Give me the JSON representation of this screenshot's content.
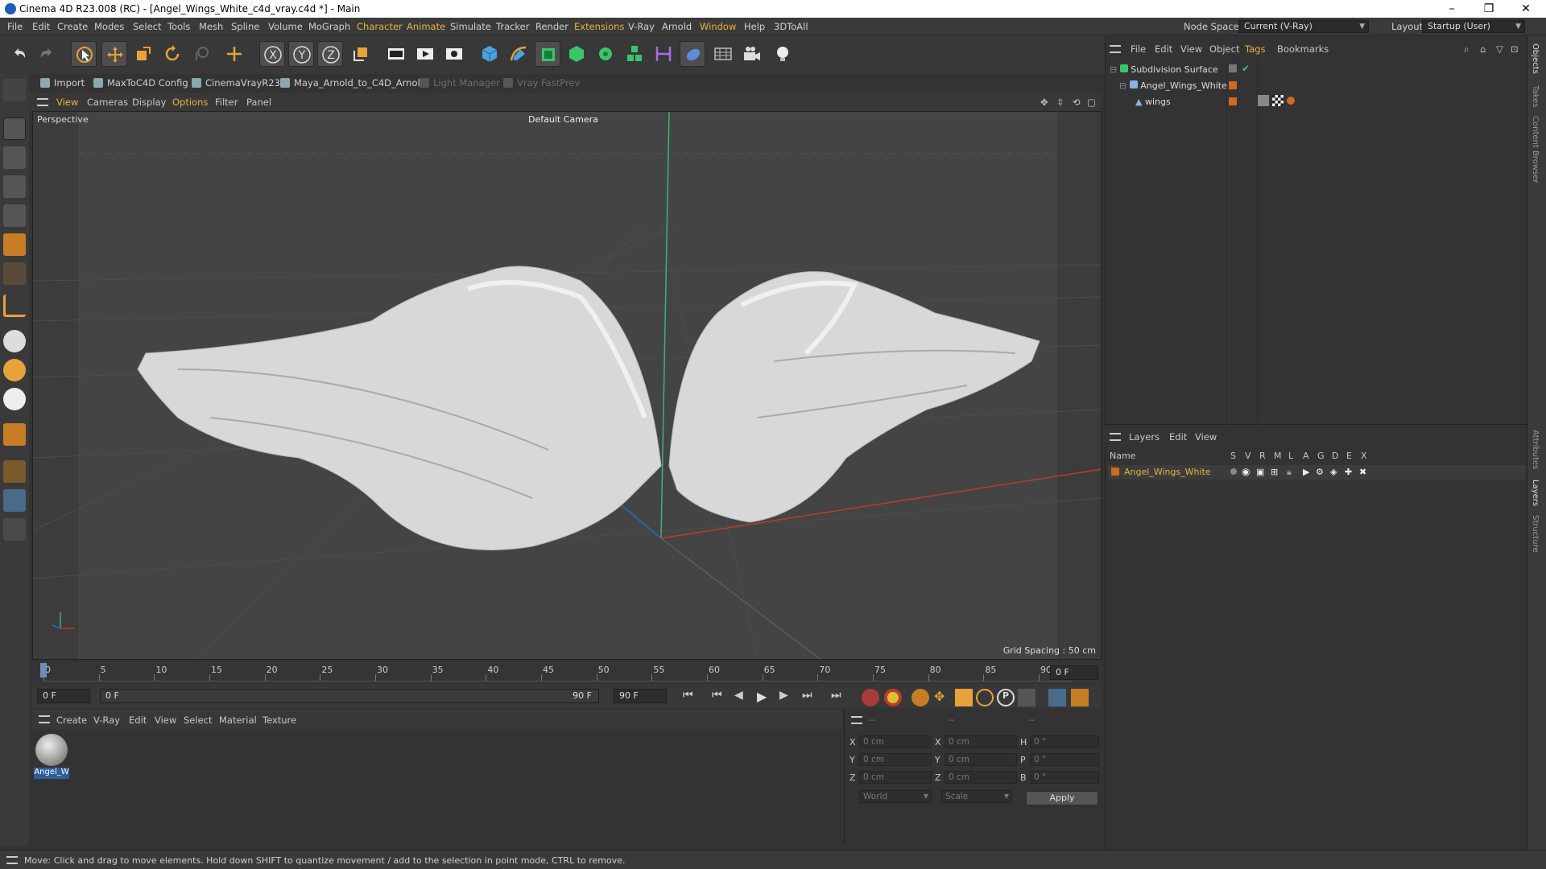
{
  "window": {
    "title": "Cinema 4D R23.008 (RC) - [Angel_Wings_White_c4d_vray.c4d *] - Main",
    "minimize": "–",
    "maximize": "❐",
    "close": "✕"
  },
  "menu": [
    "File",
    "Edit",
    "Create",
    "Modes",
    "Select",
    "Tools",
    "Mesh",
    "Spline",
    "Volume",
    "MoGraph",
    "Character",
    "Animate",
    "Simulate",
    "Tracker",
    "Render",
    "Extensions",
    "V-Ray",
    "Arnold",
    "Window",
    "Help",
    "3DToAll"
  ],
  "node_space": {
    "label": "Node Space:",
    "value": "Current (V-Ray)"
  },
  "layout": {
    "label": "Layout:",
    "value": "Startup (User)"
  },
  "plugins": [
    {
      "label": "Import",
      "enabled": true
    },
    {
      "label": "MaxToC4D Config",
      "enabled": true
    },
    {
      "label": "CinemaVrayR23",
      "enabled": true
    },
    {
      "label": "Maya_Arnold_to_C4D_Arnold",
      "enabled": true
    },
    {
      "label": "Light Manager",
      "enabled": false
    },
    {
      "label": "Vray FastPrev",
      "enabled": false
    }
  ],
  "viewport_menu": [
    "View",
    "Cameras",
    "Display",
    "Options",
    "Filter",
    "Panel"
  ],
  "viewport": {
    "projection": "Perspective",
    "camera": "Default Camera",
    "grid_spacing": "Grid Spacing : 50 cm"
  },
  "timeline": {
    "ticks": [
      "0",
      "5",
      "10",
      "15",
      "20",
      "25",
      "30",
      "35",
      "40",
      "45",
      "50",
      "55",
      "60",
      "65",
      "70",
      "75",
      "80",
      "85",
      "90"
    ],
    "frame_field": "0 F"
  },
  "anim": {
    "start": "0 F",
    "current": "0 F",
    "end_preview": "90 F",
    "end": "90 F"
  },
  "material_menu": [
    "Create",
    "V-Ray",
    "Edit",
    "View",
    "Select",
    "Material",
    "Texture"
  ],
  "material": {
    "name": "Angel_W"
  },
  "coords": {
    "header": [
      "--",
      "--",
      "--"
    ],
    "rows": [
      {
        "a_lab": "X",
        "a": "0 cm",
        "b_lab": "X",
        "b": "0 cm",
        "c_lab": "H",
        "c": "0 °"
      },
      {
        "a_lab": "Y",
        "a": "0 cm",
        "b_lab": "Y",
        "b": "0 cm",
        "c_lab": "P",
        "c": "0 °"
      },
      {
        "a_lab": "Z",
        "a": "0 cm",
        "b_lab": "Z",
        "b": "0 cm",
        "c_lab": "B",
        "c": "0 °"
      }
    ],
    "mode1": "World",
    "mode2": "Scale",
    "apply": "Apply"
  },
  "object_manager": {
    "menu": [
      "File",
      "Edit",
      "View",
      "Object",
      "Tags",
      "Bookmarks"
    ],
    "objects": [
      "Subdivision Surface",
      "Angel_Wings_White",
      "wings"
    ]
  },
  "layer_manager": {
    "menu": [
      "Layers",
      "Edit",
      "View"
    ],
    "columns": [
      "Name",
      "S",
      "V",
      "R",
      "M",
      "L",
      "A",
      "G",
      "D",
      "E",
      "X"
    ],
    "layers": [
      "Angel_Wings_White"
    ]
  },
  "side_tabs": [
    "Objects",
    "Takes",
    "Content Browser",
    "Attributes",
    "Layers",
    "Structure"
  ],
  "status": "Move: Click and drag to move elements. Hold down SHIFT to quantize movement / add to the selection in point mode, CTRL to remove.",
  "colors": {
    "accent": "#e6b43c",
    "layer_orange": "#d2691e",
    "green_axis": "#4caf50",
    "red_axis": "#c0392b"
  }
}
